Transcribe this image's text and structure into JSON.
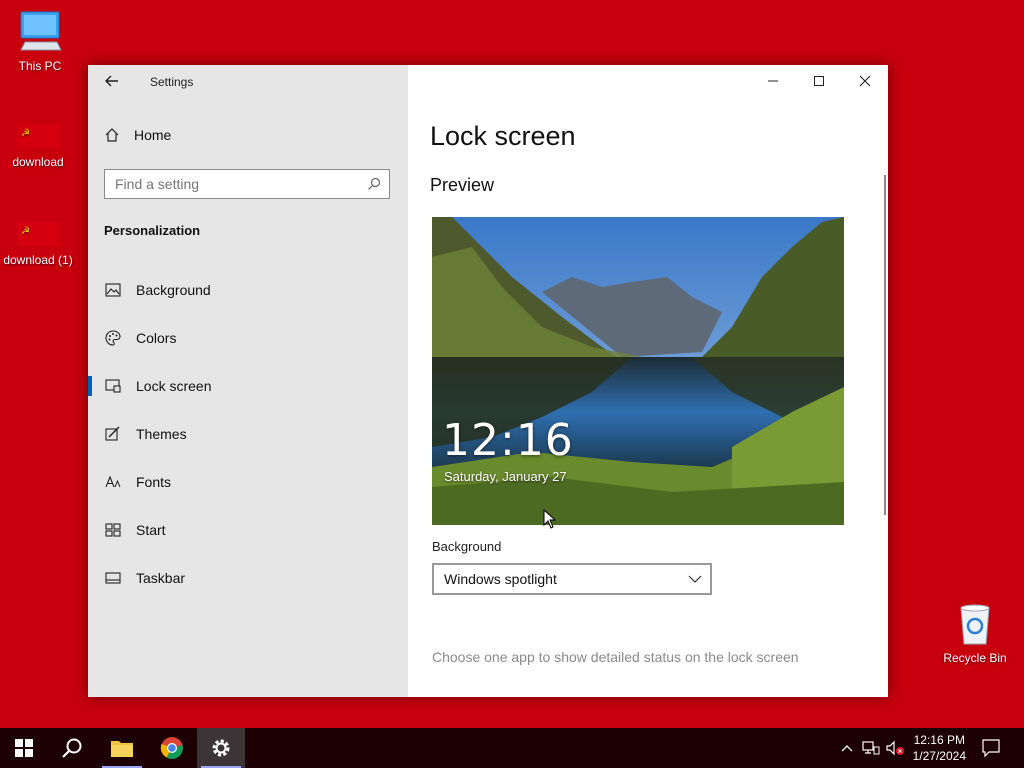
{
  "desktop": {
    "icons": [
      {
        "label": "This PC"
      },
      {
        "label": "download"
      },
      {
        "label": "download (1)"
      },
      {
        "label": "Recycle Bin"
      }
    ]
  },
  "window": {
    "app_title": "Settings",
    "nav": {
      "home": "Home",
      "search_placeholder": "Find a setting",
      "section": "Personalization",
      "items": [
        {
          "label": "Background",
          "icon": "picture-icon"
        },
        {
          "label": "Colors",
          "icon": "palette-icon"
        },
        {
          "label": "Lock screen",
          "icon": "lock-screen-icon",
          "selected": true
        },
        {
          "label": "Themes",
          "icon": "themes-icon"
        },
        {
          "label": "Fonts",
          "icon": "fonts-icon"
        },
        {
          "label": "Start",
          "icon": "start-icon"
        },
        {
          "label": "Taskbar",
          "icon": "taskbar-icon"
        }
      ]
    },
    "content": {
      "title": "Lock screen",
      "preview_heading": "Preview",
      "preview_time": "12:16",
      "preview_date": "Saturday, January 27",
      "background_label": "Background",
      "background_value": "Windows spotlight",
      "status_hint": "Choose one app to show detailed status on the lock screen"
    }
  },
  "taskbar": {
    "time": "12:16 PM",
    "date": "1/27/2024"
  },
  "colors": {
    "desktop": "#c8000e",
    "accent": "#0063b1",
    "taskbar": "#1d0003"
  }
}
